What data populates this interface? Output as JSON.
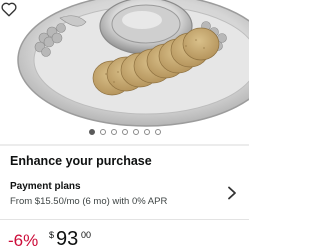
{
  "product": {
    "image_alt": "Silver chip and dip platter with crackers",
    "wishlist_icon": "heart-outline-icon"
  },
  "carousel": {
    "count": 7,
    "active_index": 0
  },
  "enhance": {
    "title": "Enhance your purchase"
  },
  "payment_plans": {
    "title": "Payment plans",
    "description": "From $15.50/mo (6 mo) with 0% APR",
    "chevron_icon": "chevron-right-icon"
  },
  "price": {
    "discount": "-6%",
    "currency": "$",
    "whole": "93",
    "fraction": "00"
  },
  "colors": {
    "discount_red": "#cc0c39",
    "text_primary": "#0f1111",
    "text_secondary": "#3f4545"
  }
}
